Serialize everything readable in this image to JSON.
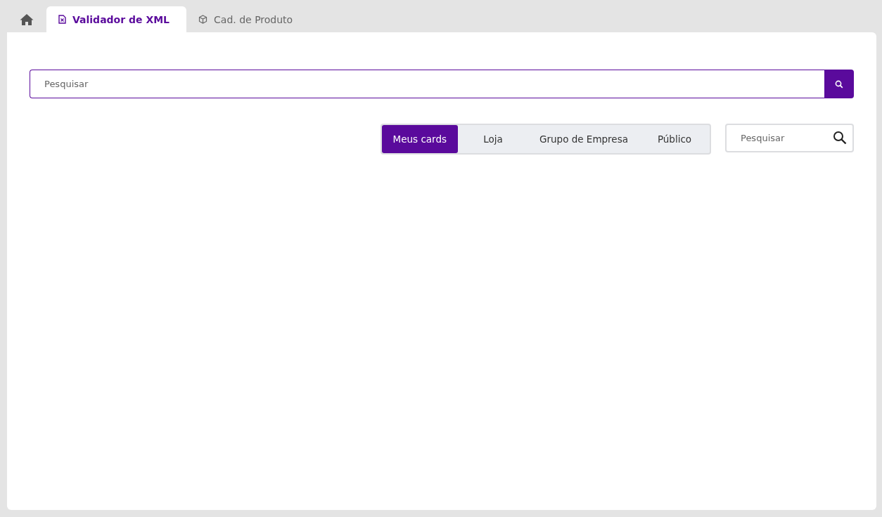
{
  "tabs": [
    {
      "kind": "home",
      "selected": false
    },
    {
      "kind": "file",
      "label": "Validador de XML",
      "selected": true
    },
    {
      "kind": "box",
      "label": "Cad. de Produto",
      "selected": false
    }
  ],
  "search": {
    "placeholder": "Pesquisar"
  },
  "filters": [
    {
      "label": "Meus cards",
      "selected": true
    },
    {
      "label": "Loja",
      "selected": false
    },
    {
      "label": "Grupo de Empresa",
      "selected": false
    },
    {
      "label": "Público",
      "selected": false
    }
  ],
  "card_search": {
    "placeholder": "Pesquisar"
  }
}
